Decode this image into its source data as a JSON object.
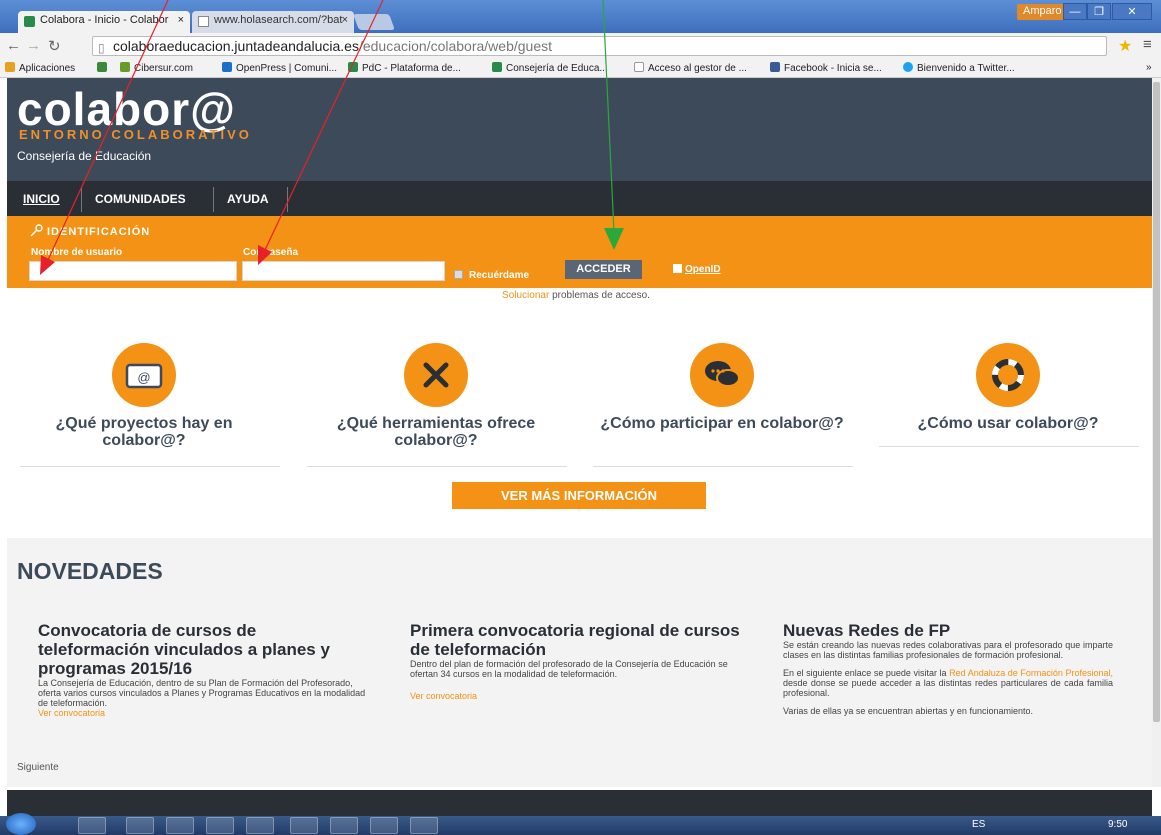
{
  "browser": {
    "tabs": [
      {
        "label": "Colabora - Inicio - Colabor",
        "close": "×"
      },
      {
        "label": "www.holasearch.com/?bat",
        "close": "×"
      }
    ],
    "user": "Amparo",
    "window_controls": [
      "—",
      "❐",
      "✕"
    ],
    "url_host": "colaboraeducacion.juntadeandalucia.es",
    "url_path": "/educacion/colabora/web/guest",
    "bookmarks": [
      {
        "label": "Aplicaciones",
        "color": "#e8a020"
      },
      {
        "label": "",
        "color": "#3a8a3a"
      },
      {
        "label": "Cibersur.com",
        "color": "#6a9a2a"
      },
      {
        "label": "OpenPress | Comuni...",
        "color": "#1d6fc9"
      },
      {
        "label": "PdC - Plataforma de...",
        "color": "#2a8a4a"
      },
      {
        "label": "Consejería de Educa...",
        "color": "#2a8a4a"
      },
      {
        "label": "Acceso al gestor de ...",
        "color": "#cccccc"
      },
      {
        "label": "Facebook - Inicia se...",
        "color": "#3b5998"
      },
      {
        "label": "Bienvenido a Twitter...",
        "color": "#1da1f2"
      }
    ],
    "bookmarks_more": "»"
  },
  "site": {
    "logo": "colabor@",
    "logo_sub": "ENTORNO COLABORATIVO",
    "consejeria": "Consejería de Educación",
    "nav": [
      "INICIO",
      "COMUNIDADES",
      "AYUDA"
    ],
    "login": {
      "title": "IDENTIFICACIÓN",
      "user_label": "Nombre de usuario",
      "pass_label": "Contraseña",
      "remember": "Recuérdame",
      "submit": "ACCEDER",
      "openid": "OpenID",
      "help_link": "Solucionar",
      "help_text": " problemas de acceso."
    },
    "features": [
      {
        "title": "¿Qué proyectos hay en colabor@?",
        "icon": "folder-at-icon"
      },
      {
        "title": "¿Qué herramientas ofrece colabor@?",
        "icon": "tools-icon"
      },
      {
        "title": "¿Cómo participar en colabor@?",
        "icon": "chat-icon"
      },
      {
        "title": "¿Cómo usar colabor@?",
        "icon": "lifebuoy-icon"
      }
    ],
    "more_info": "VER MÁS INFORMACIÓN",
    "novedades": {
      "title": "NOVEDADES",
      "items": [
        {
          "title": "Convocatoria de cursos de teleformación vinculados a planes y programas 2015/16",
          "body": "La Consejería de Educación, dentro de su Plan de Formación del Profesorado, oferta varios cursos vinculados a Planes y Programas Educativos en la modalidad de teleformación.",
          "link": "Ver convocatoria"
        },
        {
          "title": "Primera convocatoria regional de cursos de teleformación",
          "body": "Dentro del plan de formación del profesorado de la Consejería de Educación se ofertan 34 cursos en la modalidad de teleformación.",
          "link": "Ver convocatoria"
        },
        {
          "title": "Nuevas Redes de FP",
          "body1": "Se están creando las nuevas redes colaborativas para el profesorado que imparte clases en las distintas familias profesionales de formación profesional.",
          "body2a": "En el siguiente enlace se puede visitar la ",
          "body2link": "Red Andaluza de Formación Profesional,",
          "body2b": " desde donse se puede acceder a las distintas redes particulares de cada familia profesional.",
          "body3": "Varias de ellas ya se encuentran abiertas y en funcionamiento."
        }
      ],
      "next": "Siguiente"
    }
  },
  "taskbar": {
    "lang": "ES",
    "clock": "9:50"
  }
}
